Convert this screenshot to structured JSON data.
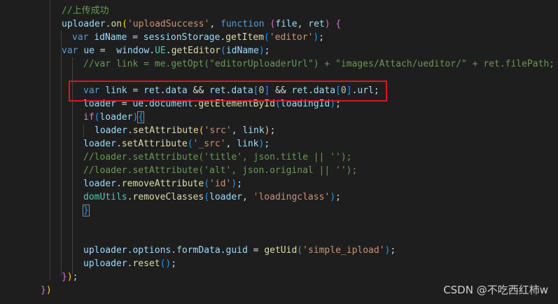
{
  "code": {
    "l1_comment": "//上传成功",
    "l2_obj": "uploader",
    "l2_method": "on",
    "l2_event": "'uploadSuccess'",
    "l2_fnkw": "function",
    "l2_p1": "file",
    "l2_p2": "ret",
    "l3_kw": "var",
    "l3_var": "idName",
    "l3_obj": "sessionStorage",
    "l3_method": "getItem",
    "l3_arg": "'editor'",
    "l4_kw": "var",
    "l4_var": "ue",
    "l4_obj": "window",
    "l4_cls": "UE",
    "l4_method": "getEditor",
    "l4_arg": "idName",
    "l5_comment": "//var link = me.getOpt(\"editorUploaderUrl\") + \"images/Attach/ueditor/\" + ret.filePath;",
    "l7_kw": "var",
    "l7_var": "link",
    "l7_ret1": "ret",
    "l7_data1": "data",
    "l7_ret2": "ret",
    "l7_data2": "data",
    "l7_idx1": "0",
    "l7_ret3": "ret",
    "l7_data3": "data",
    "l7_idx2": "0",
    "l7_url": "url",
    "l8_var": "loader",
    "l8_obj": "ue",
    "l8_doc": "document",
    "l8_method": "getElementById",
    "l8_arg": "loadingId",
    "l9_kw": "if",
    "l9_arg": "loader",
    "l10_obj": "loader",
    "l10_method": "setAttribute",
    "l10_arg1": "'src'",
    "l10_arg2": "link",
    "l11_obj": "loader",
    "l11_method": "setAttribute",
    "l11_arg1": "'_src'",
    "l11_arg2": "link",
    "l12_comment": "//loader.setAttribute('title', json.title || '');",
    "l13_comment": "//loader.setAttribute('alt', json.original || '');",
    "l14_obj": "loader",
    "l14_method": "removeAttribute",
    "l14_arg": "'id'",
    "l15_obj": "domUtils",
    "l15_method": "removeClasses",
    "l15_arg1": "loader",
    "l15_arg2": "'loadingclass'",
    "l19_obj": "uploader",
    "l19_p1": "options",
    "l19_p2": "formData",
    "l19_p3": "guid",
    "l19_fn": "getUid",
    "l19_arg": "'simple_ipload'",
    "l20_obj": "uploader",
    "l20_method": "reset"
  },
  "watermark": "CSDN @不吃西红柿w",
  "colors": {
    "background": "#1e1e1e",
    "highlight_box": "#e0141e"
  }
}
